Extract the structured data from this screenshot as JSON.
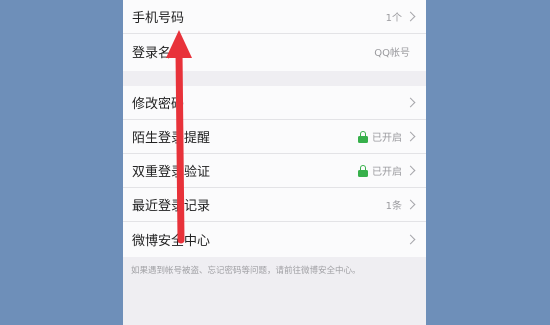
{
  "account_group": [
    {
      "label": "手机号码",
      "value": "1个"
    },
    {
      "label": "登录名",
      "value": "QQ帐号"
    }
  ],
  "security_group": [
    {
      "label": "修改密码",
      "value": ""
    },
    {
      "label": "陌生登录提醒",
      "value": "已开启"
    },
    {
      "label": "双重登录验证",
      "value": "已开启"
    },
    {
      "label": "最近登录记录",
      "value": "1条"
    },
    {
      "label": "微博安全中心",
      "value": ""
    }
  ],
  "footer_note": "如果遇到帐号被盗、忘记密码等问题，请前往微博安全中心。",
  "colors": {
    "background": "#6e8fb9",
    "arrow": "#e8323a",
    "enabled_lock": "#37b04b"
  }
}
